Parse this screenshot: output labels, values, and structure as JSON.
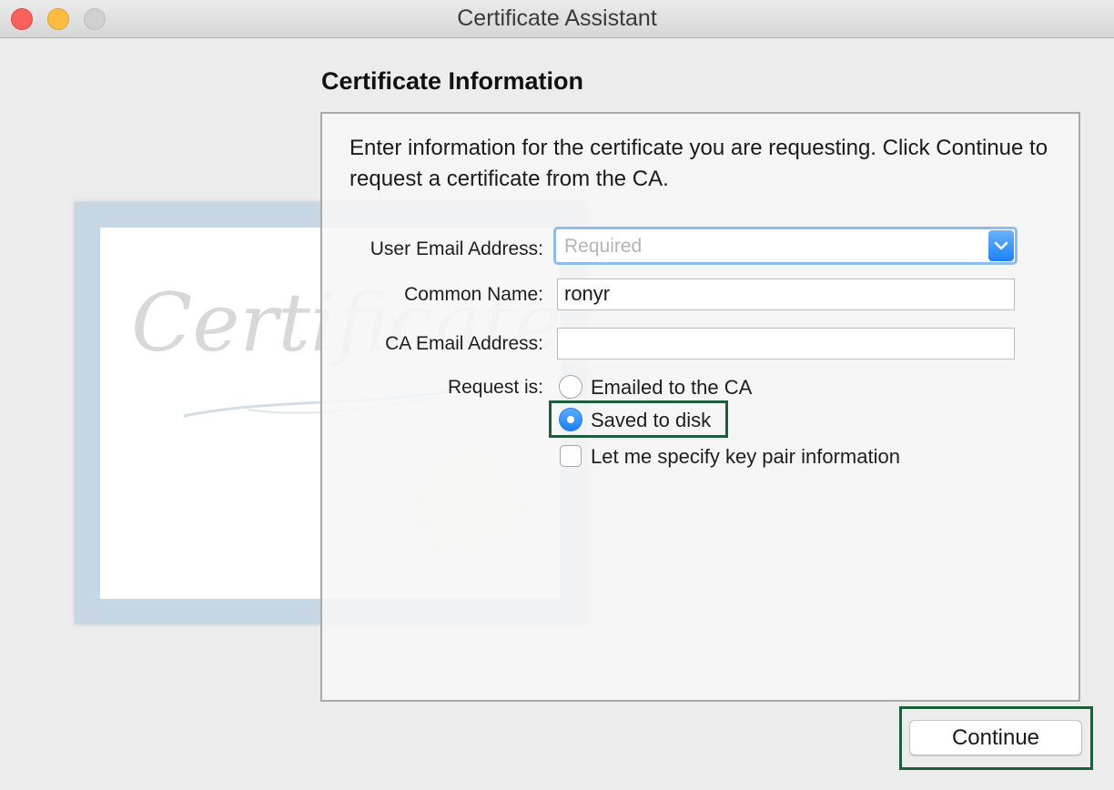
{
  "window": {
    "title": "Certificate Assistant"
  },
  "page": {
    "heading": "Certificate Information",
    "intro": "Enter information for the certificate you are requesting. Click Continue to request a certificate from the CA."
  },
  "certificate_art": {
    "script_text": "Certificate"
  },
  "form": {
    "user_email": {
      "label": "User Email Address:",
      "placeholder": "Required",
      "value": ""
    },
    "common_name": {
      "label": "Common Name:",
      "value": "ronyr"
    },
    "ca_email": {
      "label": "CA Email Address:",
      "value": ""
    },
    "request_is": {
      "label": "Request is:",
      "options": [
        {
          "label": "Emailed to the CA",
          "selected": false
        },
        {
          "label": "Saved to disk",
          "selected": true
        }
      ]
    },
    "key_pair_checkbox": {
      "label": "Let me specify key pair information",
      "checked": false
    }
  },
  "footer": {
    "continue_label": "Continue"
  },
  "colors": {
    "accent_blue": "#1b7ffb",
    "highlight_green": "#1f5c3a"
  },
  "icons": {
    "dropdown": "chevron-down-icon",
    "traffic_lights": [
      "close-icon",
      "minimize-icon",
      "zoom-icon"
    ]
  }
}
